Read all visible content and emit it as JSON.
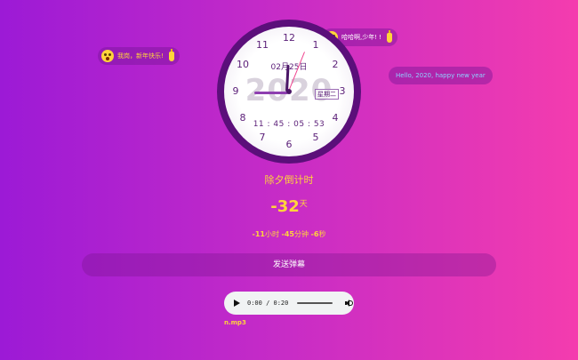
{
  "colors": {
    "accent_yellow": "#ffd43b",
    "clock_ring": "#5b0f7a",
    "background_left": "#9c1ad6",
    "background_right": "#f43cae"
  },
  "danmu": [
    {
      "text": "我岗，新年快乐!",
      "icon": "surprised-face-icon",
      "extra_icon": "bottle-icon"
    },
    {
      "text": "哈哈啊,少年! !",
      "icon": "surprised-face-icon",
      "extra_icon": "bottle-icon"
    },
    {
      "text": "Hello, 2020, happy new year"
    }
  ],
  "clock": {
    "numbers": [
      "12",
      "1",
      "2",
      "3",
      "4",
      "5",
      "6",
      "7",
      "8",
      "9",
      "10",
      "11"
    ],
    "year_watermark": "2020",
    "date": "02月25日",
    "weekday": "星期二",
    "digital_time": "11 : 45 : 05 : 53"
  },
  "countdown": {
    "title": "除夕倒计时",
    "days_value": "-32",
    "days_unit": "天",
    "hours": "-11",
    "hours_unit": "小时",
    "minutes": "-45",
    "minutes_unit": "分钟",
    "seconds": "-6",
    "seconds_unit": "秒"
  },
  "send_button_label": "发送弹幕",
  "audio": {
    "time": "0:00 / 0:20",
    "filename": "n.mp3"
  }
}
